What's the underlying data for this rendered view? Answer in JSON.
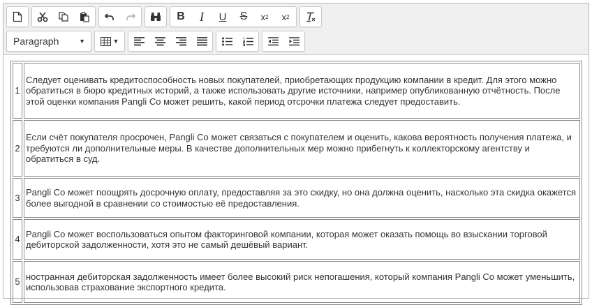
{
  "toolbar": {
    "block_format": "Paragraph",
    "groups_row1": [
      [
        "new-document-icon"
      ],
      [
        "cut-icon",
        "copy-icon",
        "paste-icon"
      ],
      [
        "undo-icon",
        "redo-icon"
      ],
      [
        "find-binoculars-icon"
      ],
      [
        "bold",
        "italic",
        "underline",
        "strikethrough",
        "subscript",
        "superscript"
      ],
      [
        "clear-formatting-icon"
      ]
    ],
    "bold_label": "B",
    "italic_label": "I",
    "underline_label": "U",
    "strike_label": "S",
    "subscript_base": "x",
    "subscript_mark": "2",
    "superscript_base": "x",
    "superscript_mark": "2",
    "clear_label": "T"
  },
  "rows": [
    {
      "num": "1",
      "text": "Следует оценивать кредитоспособность новых покупателей, приобретающих продукцию компании в кредит. Для этого можно обратиться в бюро кредитных историй, а также использовать другие источники, например опубликованную отчётность. После этой оценки компания Pangli Co может решить, какой период отсрочки платежа следует предоставить."
    },
    {
      "num": "2",
      "text": "Если счёт покупателя просрочен, Pangli Co может связаться с покупателем и оценить, какова вероятность получения платежа, и требуются ли дополнительные меры. В качестве дополнительных мер можно прибегнуть к коллекторскому агентству и обратиться в суд."
    },
    {
      "num": "3",
      "text": "Pangli Co может поощрять досрочную оплату, предоставляя за это скидку, но она должна оценить, насколько эта скидка окажется более выгодной в сравнении со стоимостью её предоставления."
    },
    {
      "num": "4",
      "text": "Pangli Co может воспользоваться опытом факторинговой компании, которая может оказать помощь во взыскании торговой дебиторской задолженности, хотя это не самый дешёвый вариант."
    },
    {
      "num": "5",
      "text": "ностранная дебиторская задолженность имеет более высокий риск непогашения, который компания Pangli Co может уменьшить, использовав страхование экспортного кредита."
    }
  ]
}
